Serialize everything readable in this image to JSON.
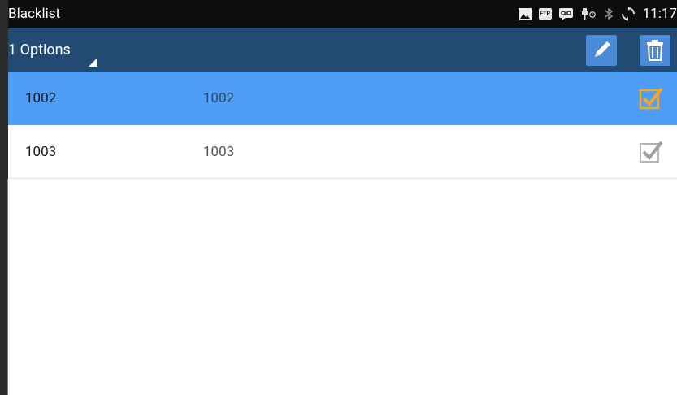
{
  "status_bar": {
    "title": "Blacklist",
    "time": "11:17",
    "icons": [
      "image-icon",
      "ftp-icon",
      "voicemail-icon",
      "usb-debug-icon",
      "bluetooth-icon",
      "sync-icon"
    ],
    "ftp_label": "FTP"
  },
  "action_bar": {
    "options_label": "1 Options",
    "edit_icon": "pencil-icon",
    "delete_icon": "trash-icon"
  },
  "entries": [
    {
      "name": "1002",
      "number": "1002",
      "checked": true,
      "selected": true
    },
    {
      "name": "1003",
      "number": "1003",
      "checked": false,
      "selected": false
    }
  ],
  "colors": {
    "status_bar_bg": "#0d0d0d",
    "action_bar_bg": "#234a72",
    "action_button_bg": "#4a8ad6",
    "selected_row_bg": "#4f9ef6",
    "checked_mark": "#f5a623",
    "unchecked_mark": "#a0a0a0"
  }
}
